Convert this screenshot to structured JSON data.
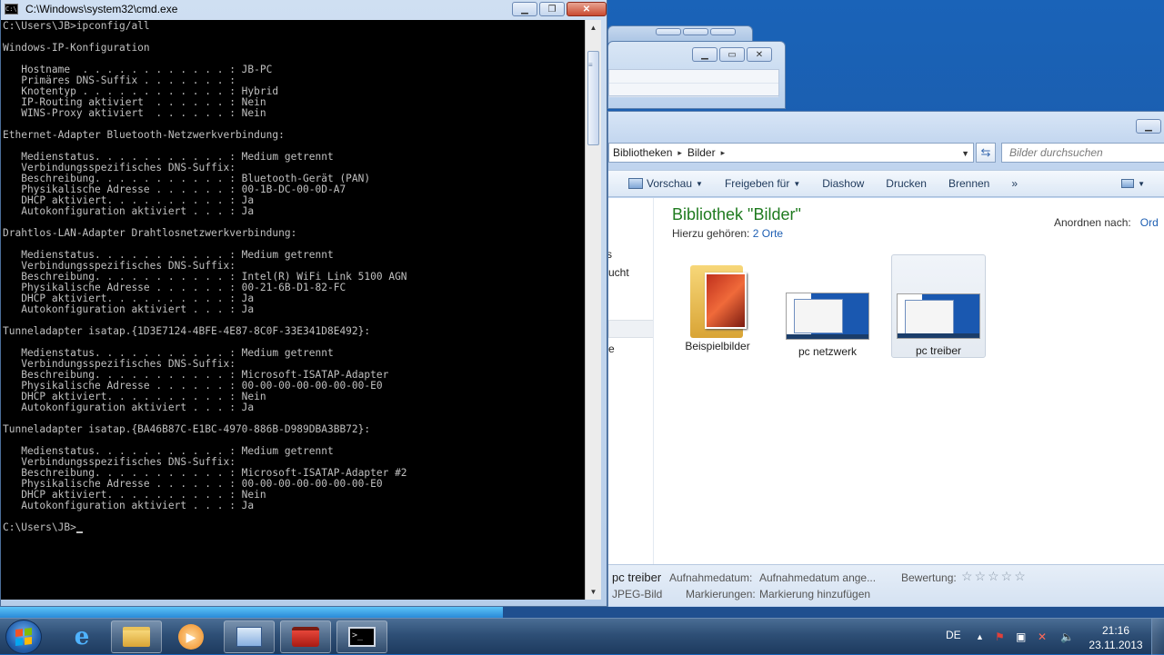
{
  "cmd": {
    "title": "C:\\Windows\\system32\\cmd.exe",
    "lines": [
      "C:\\Users\\JB>ipconfig/all",
      "",
      "Windows-IP-Konfiguration",
      "",
      "   Hostname  . . . . . . . . . . . . : JB-PC",
      "   Primäres DNS-Suffix . . . . . . . :",
      "   Knotentyp . . . . . . . . . . . . : Hybrid",
      "   IP-Routing aktiviert  . . . . . . : Nein",
      "   WINS-Proxy aktiviert  . . . . . . : Nein",
      "",
      "Ethernet-Adapter Bluetooth-Netzwerkverbindung:",
      "",
      "   Medienstatus. . . . . . . . . . . : Medium getrennt",
      "   Verbindungsspezifisches DNS-Suffix:",
      "   Beschreibung. . . . . . . . . . . : Bluetooth-Gerät (PAN)",
      "   Physikalische Adresse . . . . . . : 00-1B-DC-00-0D-A7",
      "   DHCP aktiviert. . . . . . . . . . : Ja",
      "   Autokonfiguration aktiviert . . . : Ja",
      "",
      "Drahtlos-LAN-Adapter Drahtlosnetzwerkverbindung:",
      "",
      "   Medienstatus. . . . . . . . . . . : Medium getrennt",
      "   Verbindungsspezifisches DNS-Suffix:",
      "   Beschreibung. . . . . . . . . . . : Intel(R) WiFi Link 5100 AGN",
      "   Physikalische Adresse . . . . . . : 00-21-6B-D1-82-FC",
      "   DHCP aktiviert. . . . . . . . . . : Ja",
      "   Autokonfiguration aktiviert . . . : Ja",
      "",
      "Tunneladapter isatap.{1D3E7124-4BFE-4E87-8C0F-33E341D8E492}:",
      "",
      "   Medienstatus. . . . . . . . . . . : Medium getrennt",
      "   Verbindungsspezifisches DNS-Suffix:",
      "   Beschreibung. . . . . . . . . . . : Microsoft-ISATAP-Adapter",
      "   Physikalische Adresse . . . . . . : 00-00-00-00-00-00-00-E0",
      "   DHCP aktiviert. . . . . . . . . . : Nein",
      "   Autokonfiguration aktiviert . . . : Ja",
      "",
      "Tunneladapter isatap.{BA46B87C-E1BC-4970-886B-D989DBA3BB72}:",
      "",
      "   Medienstatus. . . . . . . . . . . : Medium getrennt",
      "   Verbindungsspezifisches DNS-Suffix:",
      "   Beschreibung. . . . . . . . . . . : Microsoft-ISATAP-Adapter #2",
      "   Physikalische Adresse . . . . . . : 00-00-00-00-00-00-00-E0",
      "   DHCP aktiviert. . . . . . . . . . : Nein",
      "   Autokonfiguration aktiviert . . . : Ja",
      "",
      "C:\\Users\\JB>"
    ]
  },
  "explorer": {
    "breadcrumb": [
      "Bibliotheken",
      "Bilder"
    ],
    "search_placeholder": "Bilder durchsuchen",
    "toolbar": {
      "preview": "Vorschau",
      "share": "Freigeben für",
      "slideshow": "Diashow",
      "print": "Drucken",
      "burn": "Brennen",
      "more": "»"
    },
    "nav_partial": [
      "s",
      "ucht",
      "e"
    ],
    "library_title": "Bibliothek \"Bilder\"",
    "includes_label": "Hierzu gehören:",
    "includes_link": "2 Orte",
    "arrange_label": "Anordnen nach:",
    "arrange_value": "Ord",
    "files": [
      {
        "name": "Beispielbilder",
        "icon": "folder-icon"
      },
      {
        "name": "pc netzwerk",
        "icon": "image-thumbnail"
      },
      {
        "name": "pc treiber",
        "icon": "image-thumbnail",
        "selected": true
      }
    ],
    "details": {
      "filename": "pc treiber",
      "filetype": "JPEG-Bild",
      "date_label": "Aufnahmedatum:",
      "date_value": "Aufnahmedatum ange...",
      "tags_label": "Markierungen:",
      "tags_value": "Markierung hinzufügen",
      "rating_label": "Bewertung:",
      "rating_stars": "☆☆☆☆☆"
    }
  },
  "taskbar": {
    "progress_fraction": 0.432,
    "items": [
      {
        "icon": "internet-explorer-icon"
      },
      {
        "icon": "explorer-folder-icon",
        "open": true
      },
      {
        "icon": "media-player-icon"
      },
      {
        "icon": "control-panel-icon",
        "open": true
      },
      {
        "icon": "toolbox-icon",
        "open": true
      },
      {
        "icon": "cmd-icon",
        "open": true
      }
    ],
    "language": "DE",
    "time": "21:16",
    "date": "23.11.2013"
  }
}
